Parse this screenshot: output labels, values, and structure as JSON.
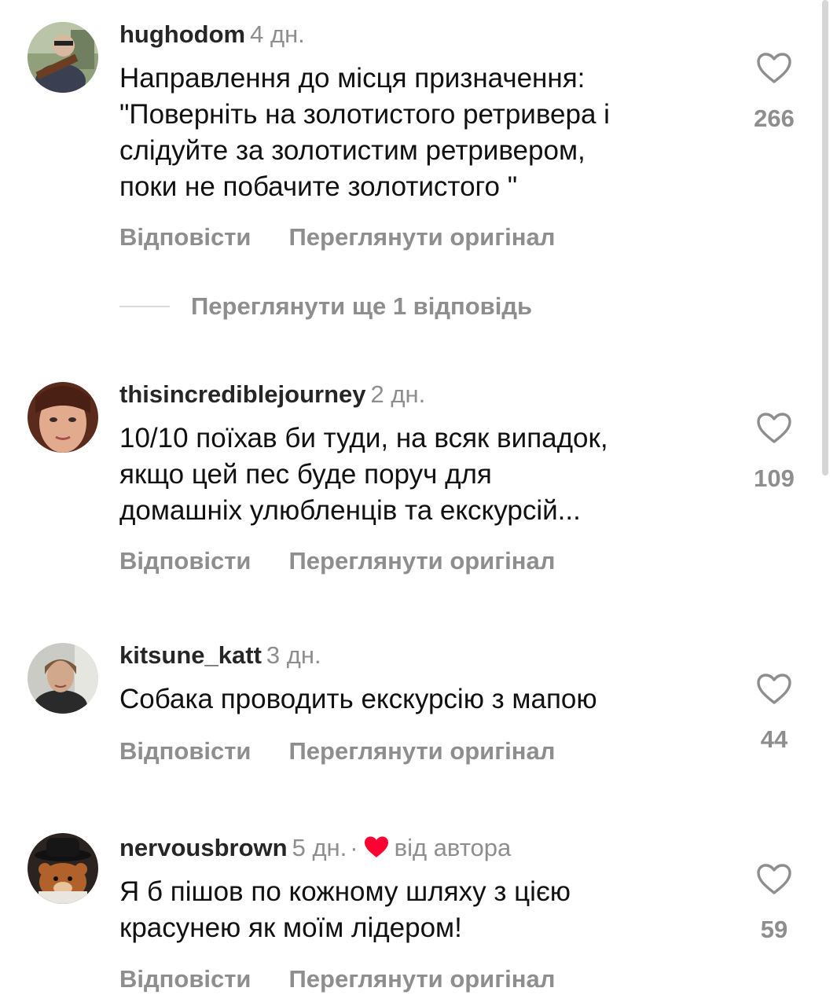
{
  "comments": [
    {
      "username": "hughodom",
      "age": "4 дн.",
      "text_lines": [
        "Направлення до місця призначення:",
        "\"Поверніть на золотистого ретривера і",
        "слідуйте за золотистим ретривером,",
        "поки не побачите золотистого \""
      ],
      "reply_label": "Відповісти",
      "original_label": "Переглянути оригінал",
      "likes": "266"
    },
    {
      "username": "thisincrediblejourney",
      "age": "2 дн.",
      "text_lines": [
        "10/10 поїхав би туди, на всяк випадок,",
        "якщо цей пес буде поруч для",
        "домашніх улюбленців та екскурсій..."
      ],
      "reply_label": "Відповісти",
      "original_label": "Переглянути оригінал",
      "likes": "109"
    },
    {
      "username": "kitsune_katt",
      "age": "3 дн.",
      "text_lines": [
        "Собака проводить екскурсію з мапою"
      ],
      "reply_label": "Відповісти",
      "original_label": "Переглянути оригінал",
      "likes": "44"
    },
    {
      "username": "nervousbrown",
      "age": "5 дн.",
      "separator": "·",
      "author_badge": "від автора",
      "text_lines": [
        "Я б пішов по кожному шляху з цією",
        "красунею як моїм лідером!"
      ],
      "reply_label": "Відповісти",
      "original_label": "Переглянути оригінал",
      "likes": "59"
    }
  ],
  "more_replies_label": "Переглянути ще 1 відповідь",
  "colors": {
    "text": "#111111",
    "secondary": "#8e8e8e",
    "author_heart": "#ff0033"
  },
  "icons": {
    "like": "heart-outline-icon",
    "author_like": "heart-filled-icon"
  }
}
